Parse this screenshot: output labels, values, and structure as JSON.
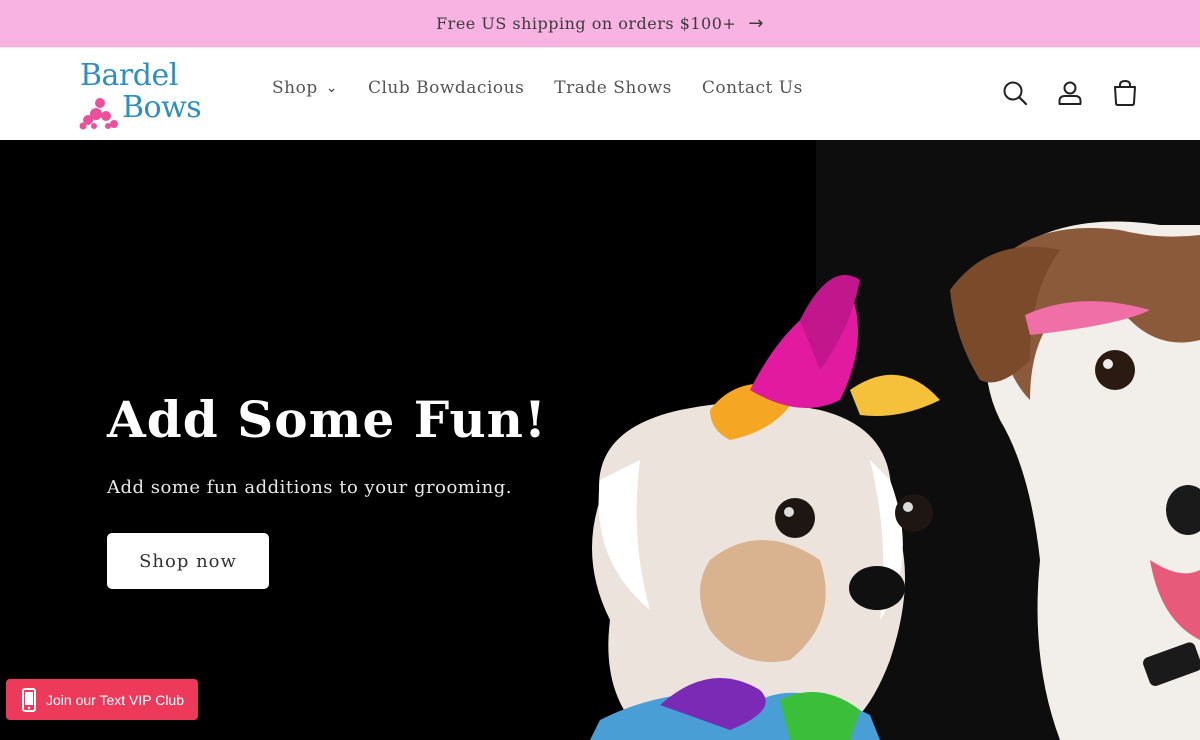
{
  "announcement": {
    "text": "Free US shipping on orders $100+",
    "arrow": "→"
  },
  "brand": {
    "line1": "Bardel",
    "line2": "Bows",
    "accent": "#2f8fbf",
    "pink": "#ee4f9c"
  },
  "nav": {
    "items": [
      {
        "label": "Shop",
        "has_dropdown": true
      },
      {
        "label": "Club Bowdacious"
      },
      {
        "label": "Trade Shows"
      },
      {
        "label": "Contact Us"
      }
    ],
    "chevron": "⌄"
  },
  "header_icons": [
    "search-icon",
    "account-icon",
    "cart-icon"
  ],
  "hero": {
    "title": "Add Some Fun!",
    "subtitle": "Add some fun additions to your grooming.",
    "cta": "Shop now"
  },
  "vip_button": {
    "label": "Join our Text VIP Club",
    "color": "#ee3a5a"
  },
  "colors": {
    "announcement_bg": "#f9b3e3",
    "hero_bg": "#000000"
  }
}
